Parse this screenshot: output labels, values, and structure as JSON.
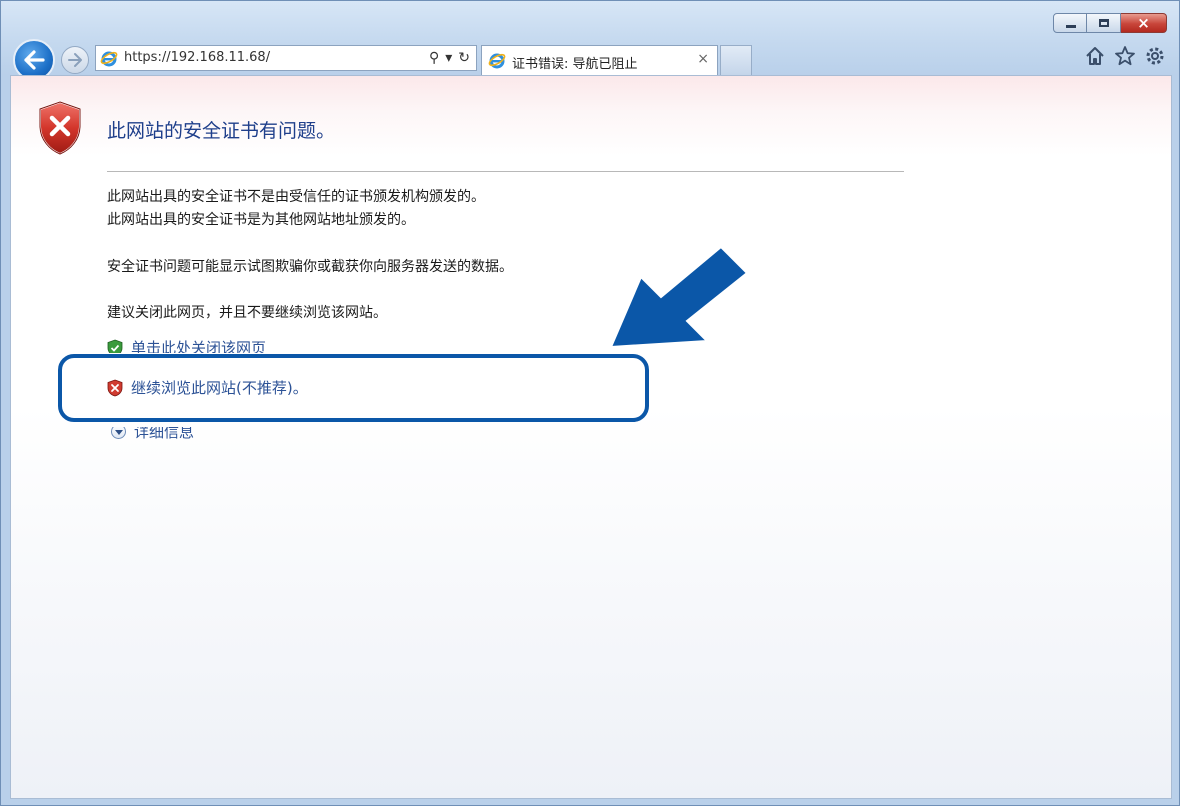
{
  "browser": {
    "address_url": "https://192.168.11.68/",
    "tab_title": "证书错误: 导航已阻止",
    "tab_close": "×",
    "addr_search": "⚲",
    "addr_dropdown": "▾",
    "addr_refresh": "↻",
    "caption_close": "×"
  },
  "page": {
    "heading": "此网站的安全证书有问题。",
    "line1": "此网站出具的安全证书不是由受信任的证书颁发机构颁发的。",
    "line2": "此网站出具的安全证书是为其他网站地址颁发的。",
    "line3": "安全证书问题可能显示试图欺骗你或截获你向服务器发送的数据。",
    "line4": "建议关闭此网页，并且不要继续浏览该网站。",
    "option_close": "单击此处关闭该网页",
    "option_continue": "继续浏览此网站(不推荐)。",
    "option_details": "详细信息"
  },
  "colors": {
    "accent": "#0b57a8",
    "link": "#2c5296",
    "heading": "#1f3f8b"
  },
  "icons": {
    "back": "back-arrow-icon",
    "forward": "forward-arrow-icon",
    "home": "home-icon",
    "favorites": "star-icon",
    "tools": "gear-icon",
    "error": "shield-error-icon"
  }
}
